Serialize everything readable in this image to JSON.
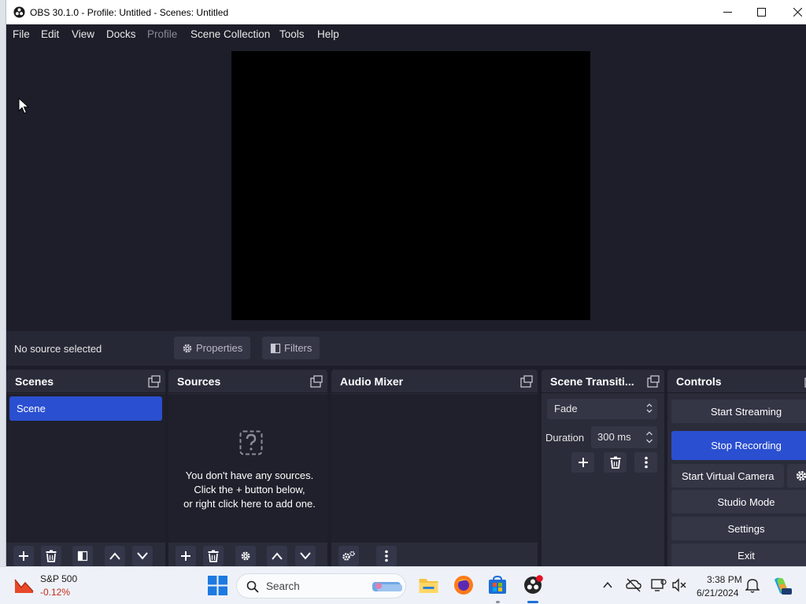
{
  "window": {
    "title": "OBS 30.1.0 - Profile: Untitled - Scenes: Untitled"
  },
  "menu": {
    "file": "File",
    "edit": "Edit",
    "view": "View",
    "docks": "Docks",
    "profile": "Profile",
    "scene_collection": "Scene Collection",
    "tools": "Tools",
    "help": "Help"
  },
  "source_toolbar": {
    "status": "No source selected",
    "properties": "Properties",
    "filters": "Filters"
  },
  "docks": {
    "scenes": {
      "title": "Scenes",
      "items": [
        "Scene"
      ]
    },
    "sources": {
      "title": "Sources",
      "empty_lines": [
        "You don't have any sources.",
        "Click the + button below,",
        "or right click here to add one."
      ]
    },
    "audio_mixer": {
      "title": "Audio Mixer"
    },
    "scene_transitions": {
      "title": "Scene Transiti...",
      "transition": "Fade",
      "duration_label": "Duration",
      "duration_value": "300 ms"
    },
    "controls": {
      "title": "Controls",
      "start_streaming": "Start Streaming",
      "stop_recording": "Stop Recording",
      "start_virtual_camera": "Start Virtual Camera",
      "studio_mode": "Studio Mode",
      "settings": "Settings",
      "exit": "Exit"
    }
  },
  "taskbar": {
    "stock_name": "S&P 500",
    "stock_change": "-0.12%",
    "search_placeholder": "Search",
    "time": "3:38 PM",
    "date": "6/21/2024"
  },
  "colors": {
    "accent": "#2a4fd0",
    "window_bg": "#1e1e2a",
    "dock_bg": "#2b2c3a",
    "button_bg": "#343545",
    "stock_down": "#c42b1c"
  }
}
